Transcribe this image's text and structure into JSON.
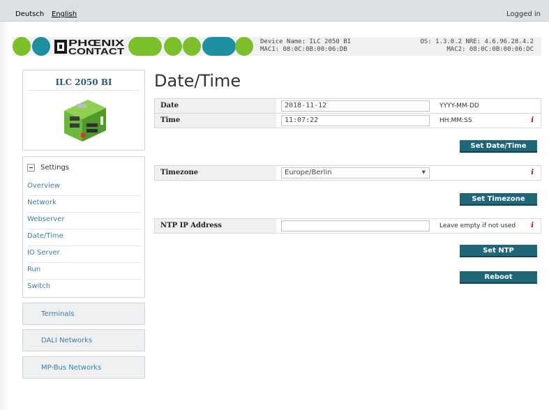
{
  "topbar": {
    "languages": [
      "Deutsch",
      "English"
    ],
    "status": "Logged in"
  },
  "header": {
    "logo_text": "PHOENIX CONTACT",
    "device_name": "Device Name: ILC 2050 BI",
    "mac1": "MAC1: 08:0C:0B:00:06:DB",
    "os_info": "OS: 1.3.0.2 NRE: 4.6.96.28.4.2",
    "mac2": "MAC2: 08:0C:0B:00:06:DC",
    "brand_colors": {
      "green": "#7bbf2a",
      "teal": "#1e8fa0",
      "dark": "#1a1a1a"
    }
  },
  "sidebar": {
    "device_title": "ILC 2050 BI",
    "settings_label": "Settings",
    "items": [
      {
        "label": "Overview"
      },
      {
        "label": "Network"
      },
      {
        "label": "Webserver"
      },
      {
        "label": "Date/Time"
      },
      {
        "label": "IO Server"
      },
      {
        "label": "Run"
      },
      {
        "label": "Switch"
      }
    ],
    "groups": [
      {
        "label": "Terminals"
      },
      {
        "label": "DALI Networks"
      },
      {
        "label": "MP-Bus Networks"
      }
    ]
  },
  "main": {
    "title": "Date/Time",
    "date": {
      "label": "Date",
      "value": "2018-11-12",
      "hint": "YYYY-MM-DD"
    },
    "time": {
      "label": "Time",
      "value": "11:07:22",
      "hint": "HH:MM:SS",
      "info": "i"
    },
    "set_datetime_label": "Set Date/Time",
    "timezone": {
      "label": "Timezone",
      "value": "Europe/Berlin",
      "info": "i"
    },
    "set_timezone_label": "Set Timezone",
    "ntp": {
      "label": "NTP IP Address",
      "value": "",
      "hint": "Leave empty if not used",
      "info": "i"
    },
    "set_ntp_label": "Set NTP",
    "reboot_label": "Reboot"
  }
}
